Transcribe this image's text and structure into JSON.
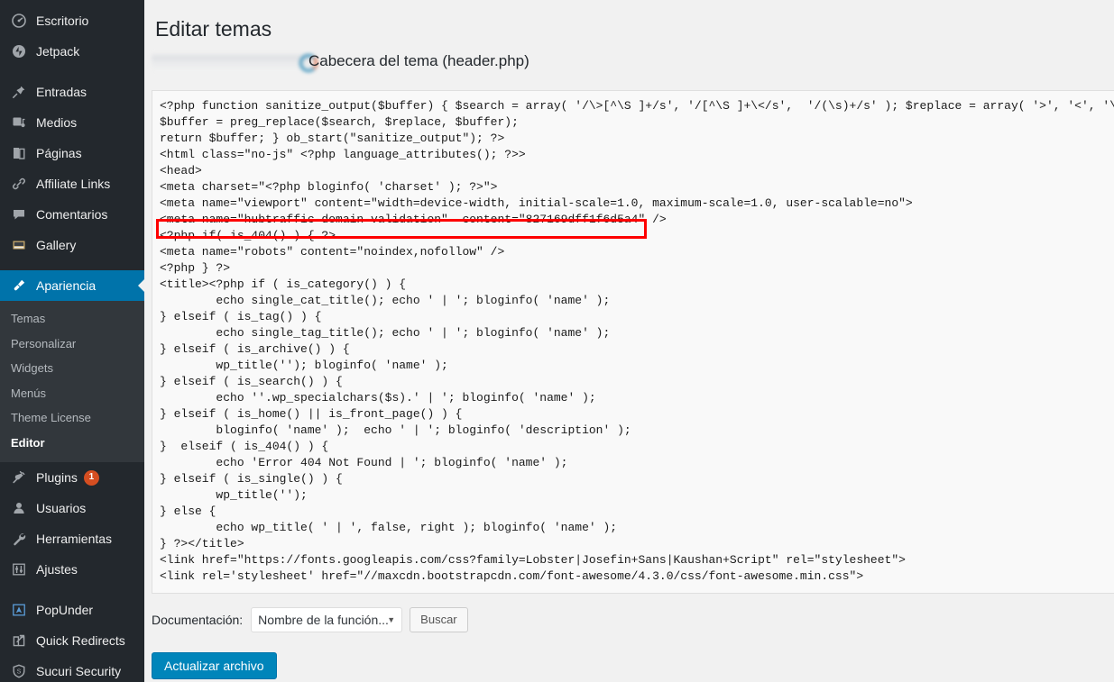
{
  "sidebar": {
    "items": [
      {
        "label": "Escritorio",
        "icon": "dashboard-icon",
        "current": false
      },
      {
        "label": "Jetpack",
        "icon": "jetpack-icon",
        "current": false
      },
      {
        "label": "Entradas",
        "icon": "pin-icon",
        "current": false
      },
      {
        "label": "Medios",
        "icon": "media-icon",
        "current": false
      },
      {
        "label": "Páginas",
        "icon": "pages-icon",
        "current": false
      },
      {
        "label": "Affiliate Links",
        "icon": "link-icon",
        "current": false
      },
      {
        "label": "Comentarios",
        "icon": "comment-icon",
        "current": false
      },
      {
        "label": "Gallery",
        "icon": "gallery-icon",
        "current": false
      },
      {
        "label": "Apariencia",
        "icon": "appearance-brush-icon",
        "current": true
      },
      {
        "label": "Plugins",
        "icon": "plugin-icon",
        "current": false,
        "badge": "1"
      },
      {
        "label": "Usuarios",
        "icon": "users-icon",
        "current": false
      },
      {
        "label": "Herramientas",
        "icon": "tools-wrench-icon",
        "current": false
      },
      {
        "label": "Ajustes",
        "icon": "settings-sliders-icon",
        "current": false
      },
      {
        "label": "PopUnder",
        "icon": "popunder-icon",
        "current": false
      },
      {
        "label": "Quick Redirects",
        "icon": "external-link-icon",
        "current": false
      },
      {
        "label": "Sucuri Security",
        "icon": "shield-icon",
        "current": false
      }
    ],
    "submenu": [
      {
        "label": "Temas",
        "active": false
      },
      {
        "label": "Personalizar",
        "active": false
      },
      {
        "label": "Widgets",
        "active": false
      },
      {
        "label": "Menús",
        "active": false
      },
      {
        "label": "Theme License",
        "active": false
      },
      {
        "label": "Editor",
        "active": true
      }
    ],
    "accent_color": "#0073aa",
    "background_color": "#23282d",
    "submenu_background": "#32373c",
    "badge_color": "#d54e21"
  },
  "main": {
    "page_title": "Editar temas",
    "file_title": "Cabecera del tema (header.php)",
    "code": "<?php function sanitize_output($buffer) { $search = array( '/\\>[^\\S ]+/s', '/[^\\S ]+\\</s',  '/(\\s)+/s' ); $replace = array( '>', '<', '\\\\1' );\n$buffer = preg_replace($search, $replace, $buffer);\nreturn $buffer; } ob_start(\"sanitize_output\"); ?>\n<html class=\"no-js\" <?php language_attributes(); ?>>\n<head>\n<meta charset=\"<?php bloginfo( 'charset' ); ?>\">\n<meta name=\"viewport\" content=\"width=device-width, initial-scale=1.0, maximum-scale=1.0, user-scalable=no\">\n<meta name=\"hubtraffic-domain-validation\"  content=\"827169dff1f6d5a4\" />\n<?php if( is_404() ) { ?>\n<meta name=\"robots\" content=\"noindex,nofollow\" />\n<?php } ?>\n<title><?php if ( is_category() ) {\n        echo single_cat_title(); echo ' | '; bloginfo( 'name' );\n} elseif ( is_tag() ) {\n        echo single_tag_title(); echo ' | '; bloginfo( 'name' );\n} elseif ( is_archive() ) {\n        wp_title(''); bloginfo( 'name' );\n} elseif ( is_search() ) {\n        echo ''.wp_specialchars($s).' | '; bloginfo( 'name' );\n} elseif ( is_home() || is_front_page() ) {\n        bloginfo( 'name' );  echo ' | '; bloginfo( 'description' );\n}  elseif ( is_404() ) {\n        echo 'Error 404 Not Found | '; bloginfo( 'name' );\n} elseif ( is_single() ) {\n        wp_title('');\n} else {\n        echo wp_title( ' | ', false, right ); bloginfo( 'name' );\n} ?></title>\n<link href=\"https://fonts.googleapis.com/css?family=Lobster|Josefin+Sans|Kaushan+Script\" rel=\"stylesheet\">\n<link rel='stylesheet' href=\"//maxcdn.bootstrapcdn.com/font-awesome/4.3.0/css/font-awesome.min.css\">",
    "highlighted_line": "<meta name=\"hubtraffic-domain-validation\"  content=\"827169dff1f6d5a4\" />",
    "highlight_color": "#fe0000"
  },
  "controls": {
    "doc_label": "Documentación:",
    "doc_select_value": "Nombre de la función...",
    "doc_select_caret": "▼",
    "search_button": "Buscar",
    "submit_button": "Actualizar archivo"
  }
}
